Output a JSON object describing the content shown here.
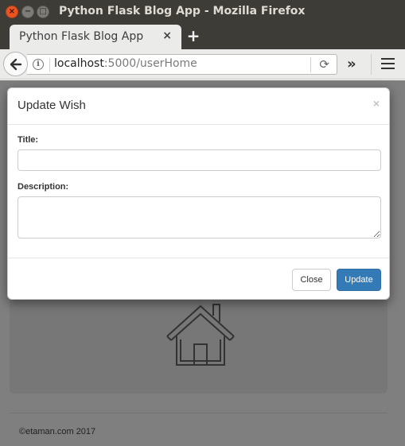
{
  "window": {
    "title": "Python Flask Blog App - Mozilla Firefox",
    "controls": {
      "close": "×",
      "minimize": "−",
      "maximize": "□"
    }
  },
  "tab": {
    "label": "Python Flask Blog App",
    "close": "×",
    "new_tab": "+"
  },
  "navbar": {
    "url_host": "localhost",
    "url_rest": ":5000/userHome",
    "info": "i",
    "reload": "⟳",
    "overflow": "»"
  },
  "page": {
    "footer": "©etaman.com 2017"
  },
  "modal": {
    "title": "Update Wish",
    "close": "×",
    "title_label": "Title:",
    "title_value": "",
    "description_label": "Description:",
    "description_value": "",
    "close_button": "Close",
    "update_button": "Update"
  },
  "colors": {
    "primary": "#337ab7",
    "titlebar": "#3d3c37",
    "close_button": "#e95420"
  }
}
